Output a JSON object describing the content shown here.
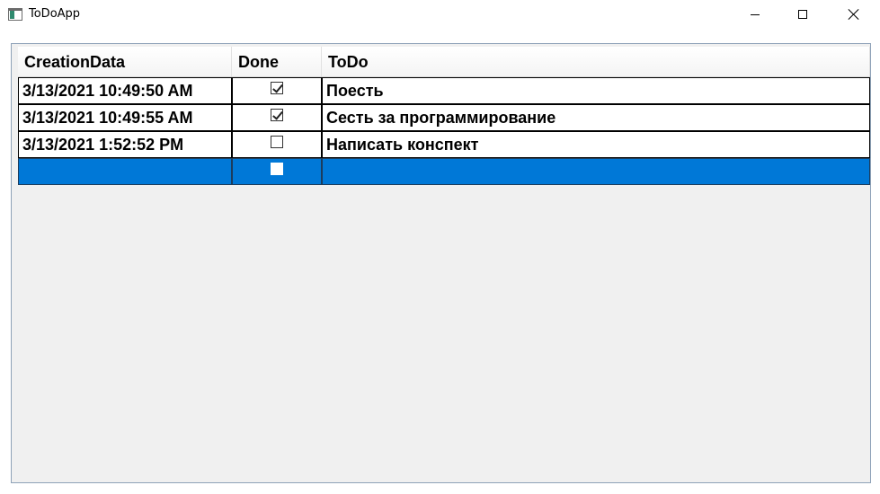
{
  "window": {
    "title": "ToDoApp"
  },
  "grid": {
    "columns": [
      "CreationData",
      "Done",
      "ToDo"
    ],
    "rows": [
      {
        "creation": "3/13/2021 10:49:50 AM",
        "done": true,
        "todo": "Поесть"
      },
      {
        "creation": "3/13/2021 10:49:55 AM",
        "done": true,
        "todo": "Сесть за программирование"
      },
      {
        "creation": "3/13/2021 1:52:52 PM",
        "done": false,
        "todo": "Написать конспект"
      },
      {
        "creation": "",
        "done": false,
        "todo": "",
        "selected": true
      }
    ]
  },
  "colors": {
    "selection": "#0078d7",
    "grid_border": "#8ea2b8",
    "grid_background": "#f0f0f0"
  },
  "icons": [
    "app-icon",
    "minimize-icon",
    "maximize-icon",
    "close-icon",
    "checkbox-icon"
  ]
}
